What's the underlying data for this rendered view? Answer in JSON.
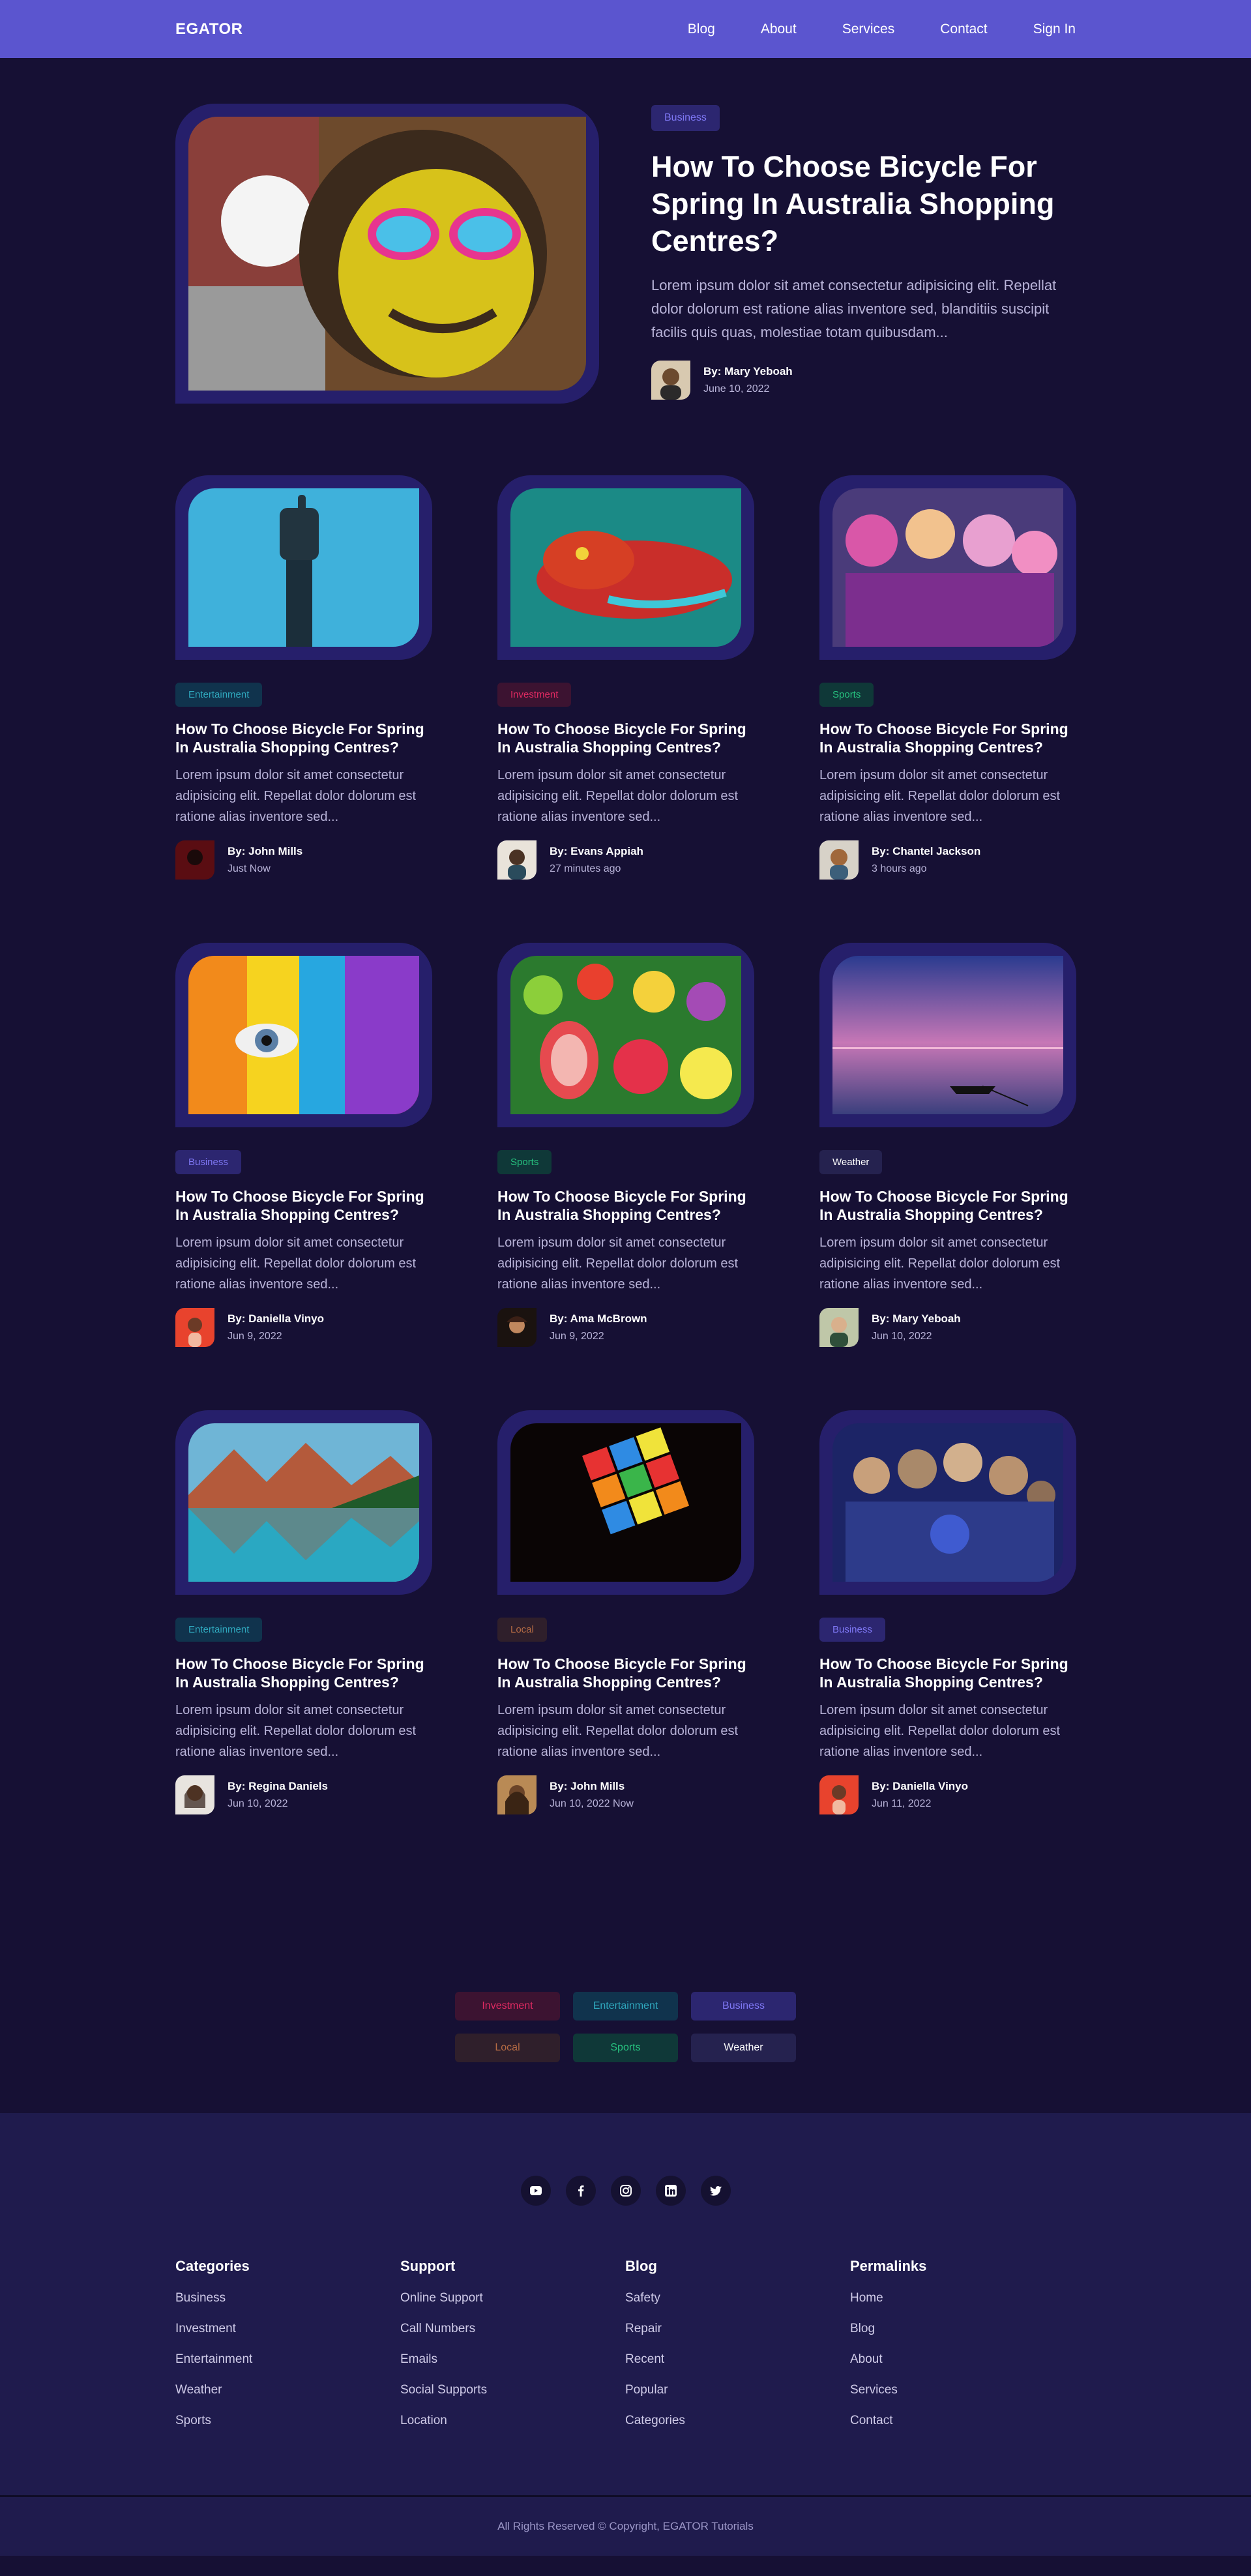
{
  "nav": {
    "logo": "EGATOR",
    "links": [
      "Blog",
      "About",
      "Services",
      "Contact",
      "Sign In"
    ]
  },
  "hero": {
    "tag": "Business",
    "title": "How To Choose Bicycle For Spring In Australia Shopping Centres?",
    "excerpt": "Lorem ipsum dolor sit amet consectetur adipisicing elit. Repellat dolor dolorum est ratione alias inventore sed, blanditiis suscipit facilis quis quas, molestiae totam quibusdam...",
    "author": "By: Mary Yeboah",
    "date": "June 10, 2022",
    "image_desc": "graffiti monkey with sunglasses"
  },
  "posts": [
    {
      "tag": "Entertainment",
      "title": "How To Choose Bicycle For Spring In Australia Shopping Centres?",
      "excerpt": "Lorem ipsum dolor sit amet consectetur adipisicing elit. Repellat dolor dolorum est ratione alias inventore sed...",
      "author": "By: John Mills",
      "date": "Just Now"
    },
    {
      "tag": "Investment",
      "title": "How To Choose Bicycle For Spring In Australia Shopping Centres?",
      "excerpt": "Lorem ipsum dolor sit amet consectetur adipisicing elit. Repellat dolor dolorum est ratione alias inventore sed...",
      "author": "By: Evans Appiah",
      "date": "27 minutes ago"
    },
    {
      "tag": "Sports",
      "title": "How To Choose Bicycle For Spring In Australia Shopping Centres?",
      "excerpt": "Lorem ipsum dolor sit amet consectetur adipisicing elit. Repellat dolor dolorum est ratione alias inventore sed...",
      "author": "By: Chantel Jackson",
      "date": "3 hours ago"
    },
    {
      "tag": "Business",
      "title": "How To Choose Bicycle For Spring In Australia Shopping Centres?",
      "excerpt": "Lorem ipsum dolor sit amet consectetur adipisicing elit. Repellat dolor dolorum est ratione alias inventore sed...",
      "author": "By: Daniella Vinyo",
      "date": "Jun 9, 2022"
    },
    {
      "tag": "Sports",
      "title": "How To Choose Bicycle For Spring In Australia Shopping Centres?",
      "excerpt": "Lorem ipsum dolor sit amet consectetur adipisicing elit. Repellat dolor dolorum est ratione alias inventore sed...",
      "author": "By: Ama McBrown",
      "date": "Jun 9, 2022"
    },
    {
      "tag": "Weather",
      "title": "How To Choose Bicycle For Spring In Australia Shopping Centres?",
      "excerpt": "Lorem ipsum dolor sit amet consectetur adipisicing elit. Repellat dolor dolorum est ratione alias inventore sed...",
      "author": "By: Mary Yeboah",
      "date": "Jun 10, 2022"
    },
    {
      "tag": "Entertainment",
      "title": "How To Choose Bicycle For Spring In Australia Shopping Centres?",
      "excerpt": "Lorem ipsum dolor sit amet consectetur adipisicing elit. Repellat dolor dolorum est ratione alias inventore sed...",
      "author": "By: Regina Daniels",
      "date": "Jun 10, 2022"
    },
    {
      "tag": "Local",
      "title": "How To Choose Bicycle For Spring In Australia Shopping Centres?",
      "excerpt": "Lorem ipsum dolor sit amet consectetur adipisicing elit. Repellat dolor dolorum est ratione alias inventore sed...",
      "author": "By: John Mills",
      "date": "Jun 10, 2022 Now"
    },
    {
      "tag": "Business",
      "title": "How To Choose Bicycle For Spring In Australia Shopping Centres?",
      "excerpt": "Lorem ipsum dolor sit amet consectetur adipisicing elit. Repellat dolor dolorum est ratione alias inventore sed...",
      "author": "By: Daniella Vinyo",
      "date": "Jun 11, 2022"
    }
  ],
  "tag_cloud": [
    "Investment",
    "Entertainment",
    "Business",
    "Local",
    "Sports",
    "Weather"
  ],
  "socials": [
    "youtube-icon",
    "facebook-icon",
    "instagram-icon",
    "linkedin-icon",
    "twitter-icon"
  ],
  "footer": {
    "columns": [
      {
        "heading": "Categories",
        "links": [
          "Business",
          "Investment",
          "Entertainment",
          "Weather",
          "Sports"
        ]
      },
      {
        "heading": "Support",
        "links": [
          "Online Support",
          "Call Numbers",
          "Emails",
          "Social Supports",
          "Location"
        ]
      },
      {
        "heading": "Blog",
        "links": [
          "Safety",
          "Repair",
          "Recent",
          "Popular",
          "Categories"
        ]
      },
      {
        "heading": "Permalinks",
        "links": [
          "Home",
          "Blog",
          "About",
          "Services",
          "Contact"
        ]
      }
    ],
    "copyright": "All Rights Reserved © Copyright, EGATOR Tutorials"
  },
  "colors": {
    "nav": "#5b55cf",
    "page": "#161034",
    "frame": "#261f6b",
    "footer": "#1f1b4d"
  }
}
